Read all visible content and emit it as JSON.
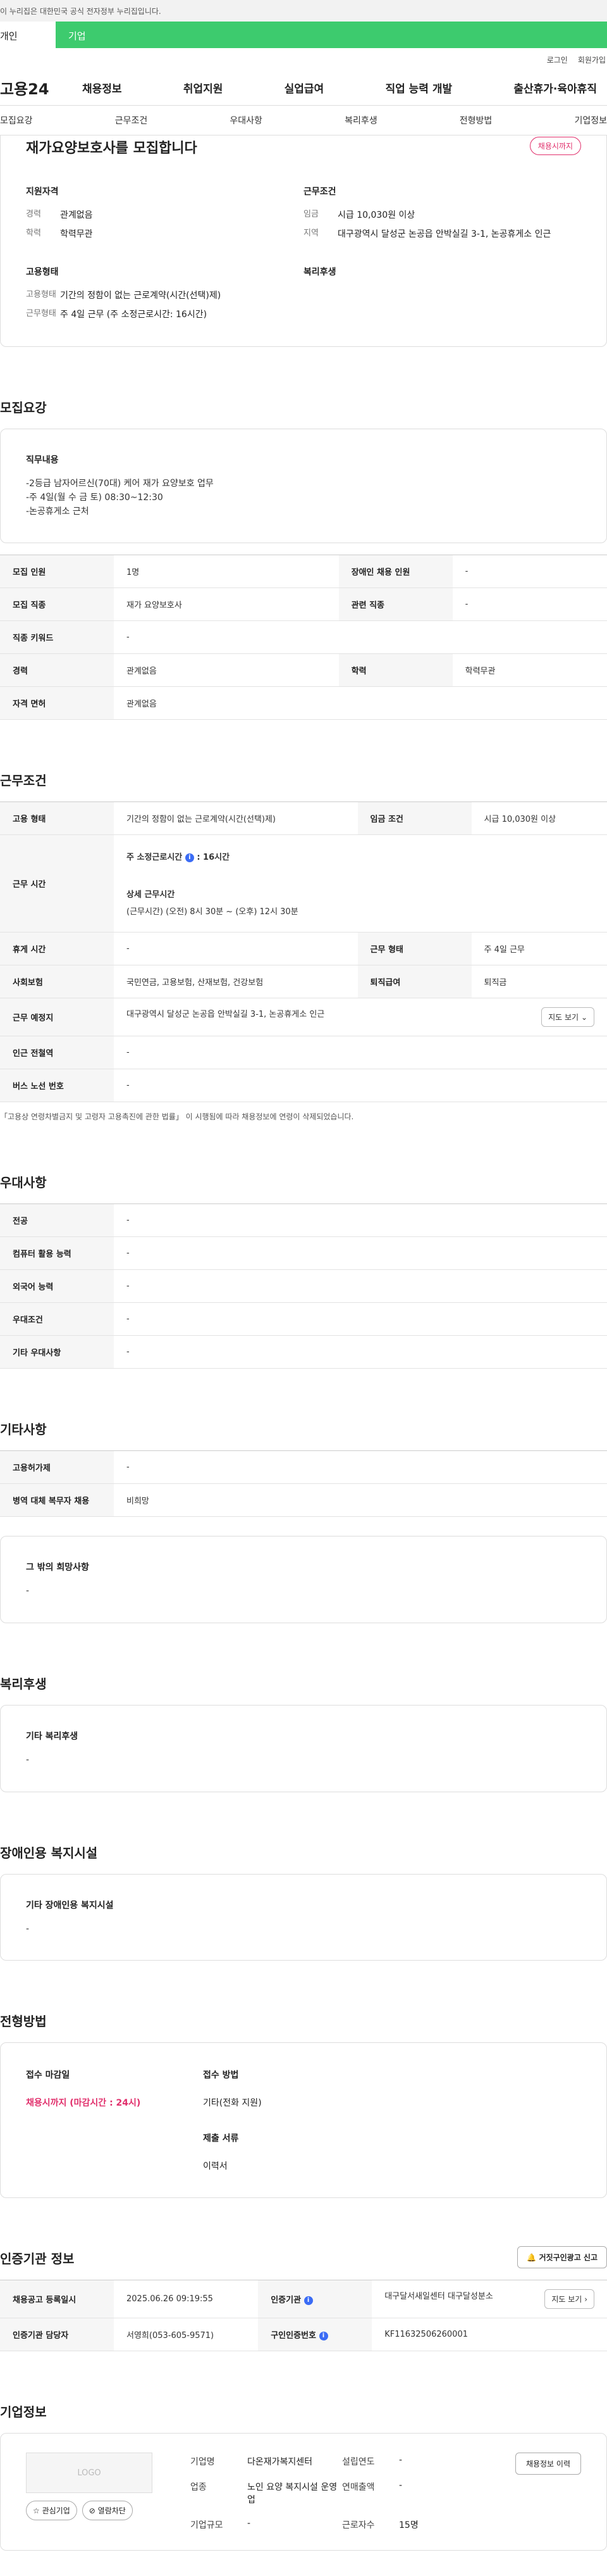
{
  "gov_banner": "이 누리집은 대한민국 공식 전자정부 누리집입니다.",
  "user_tabs": [
    "개인",
    "기업"
  ],
  "util": [
    "로그인",
    "회원가입"
  ],
  "logo": "고용24",
  "gnb": [
    "채용정보",
    "취업지원",
    "실업급여",
    "직업 능력 개발",
    "출산휴가·육아휴직"
  ],
  "anchors": [
    "모집요강",
    "근무조건",
    "우대사항",
    "복리후생",
    "전형방법",
    "기업정보"
  ],
  "job": {
    "title": "재가요양보호사를 모집합니다",
    "status": "채용시까지",
    "qual_h": "지원자격",
    "qual": [
      {
        "k": "경력",
        "v": "관계없음"
      },
      {
        "k": "학력",
        "v": "학력무관"
      }
    ],
    "cond_h": "근무조건",
    "cond": [
      {
        "k": "임금",
        "v": "시급 10,030원 이상"
      },
      {
        "k": "지역",
        "v": "대구광역시 달성군 논공읍 안박실길 3-1, 논공휴게소 인근"
      }
    ],
    "emp_h": "고용형태",
    "emp": [
      {
        "k": "고용형태",
        "v": "기간의 정함이 없는 근로계약(시간(선택)제)"
      },
      {
        "k": "근무형태",
        "v": "주 4일 근무 (주 소정근로시간: 16시간)"
      }
    ],
    "welfare_h": "복리후생"
  },
  "recruit": {
    "title": "모집요강",
    "duty_h": "직무내용",
    "duty_lines": [
      "-2등급 남자어르신(70대) 케어 재가 요양보호 업무",
      "-주 4일(월 수 금 토) 08:30~12:30",
      "-논공휴게소 근처"
    ],
    "rows": [
      [
        "모집 인원",
        "1명",
        "장애인 채용 인원",
        "-"
      ],
      [
        "모집 직종",
        "재가 요양보호사",
        "관련 직종",
        "-"
      ],
      [
        "직종 키워드",
        "-"
      ],
      [
        "경력",
        "관계없음",
        "학력",
        "학력무관"
      ],
      [
        "자격 면허",
        "관계없음"
      ]
    ]
  },
  "work": {
    "title": "근무조건",
    "emp_type_k": "고용 형태",
    "emp_type_v": "기간의 정함이 없는 근로계약(시간(선택)제)",
    "wage_k": "임금 조건",
    "wage_v": "시급 10,030원 이상",
    "hours_k": "근무 시간",
    "weekly_lbl": "주 소정근로시간",
    "weekly_v": ": 16시간",
    "detail_lbl": "상세 근무시간",
    "detail_v": "(근무시간) (오전) 8시 30분 ~ (오후) 12시 30분",
    "rows": [
      [
        "휴게 시간",
        "-",
        "근무 형태",
        "주 4일 근무"
      ],
      [
        "사회보험",
        "국민연금, 고용보험, 산재보험, 건강보험",
        "퇴직급여",
        "퇴직금"
      ]
    ],
    "place_k": "근무 예정지",
    "place_v": "대구광역시 달성군 논공읍 안박실길 3-1, 논공휴게소 인근",
    "map_btn": "지도 보기",
    "rows2": [
      [
        "인근 전철역",
        "-"
      ],
      [
        "버스 노선 번호",
        "-"
      ]
    ],
    "note": "「고용상 연령차별금지 및 고령자 고용촉진에 관한 법률」 이 시행됨에 따라 채용정보에 연령이 삭제되었습니다."
  },
  "pref": {
    "title": "우대사항",
    "rows": [
      [
        "전공",
        "-"
      ],
      [
        "컴퓨터 활용 능력",
        "-"
      ],
      [
        "외국어 능력",
        "-"
      ],
      [
        "우대조건",
        "-"
      ],
      [
        "기타 우대사항",
        "-"
      ]
    ]
  },
  "etc": {
    "title": "기타사항",
    "rows": [
      [
        "고용허가제",
        "-"
      ],
      [
        "병역 대체 복무자 채용",
        "비희망"
      ]
    ],
    "box_h": "그 밖의 희망사항",
    "box_v": "-"
  },
  "welfare": {
    "title": "복리후생",
    "box_h": "기타 복리후생",
    "box_v": "-"
  },
  "disab": {
    "title": "장애인용 복지시설",
    "box_h": "기타 장애인용 복지시설",
    "box_v": "-"
  },
  "process": {
    "title": "전형방법",
    "deadline_h": "접수 마감일",
    "deadline_v": "채용시까지 (마감시간 : 24시)",
    "method_h": "접수 방법",
    "method_v": "기타(전화 지원)",
    "docs_h": "제출 서류",
    "docs_v": "이력서"
  },
  "cert": {
    "title": "인증기관 정보",
    "report_btn": "거짓구인광고 신고",
    "reg_k": "채용공고 등록일시",
    "reg_v": "2025.06.26 09:19:55",
    "org_k": "인증기관",
    "org_v": "대구달서새일센터 대구달성분소",
    "map_btn": "지도 보기",
    "staff_k": "인증기관 담당자",
    "staff_v": "서영희(053-605-9571)",
    "no_k": "구인인증번호",
    "no_v": "KF11632506260001"
  },
  "company": {
    "title": "기업정보",
    "logo": "LOGO",
    "fav": "관심기업",
    "block": "열람차단",
    "hist_btn": "채용정보 이력",
    "name_k": "기업명",
    "name_v": "다온재가복지센터",
    "year_k": "설립연도",
    "year_v": "-",
    "ind_k": "업종",
    "ind_v": "노인 요양 복지시설 운영업",
    "rev_k": "연매출액",
    "rev_v": "-",
    "emp_k": "근로자수",
    "emp_v": "15명",
    "size_k": "기업규모",
    "size_v": "-"
  }
}
